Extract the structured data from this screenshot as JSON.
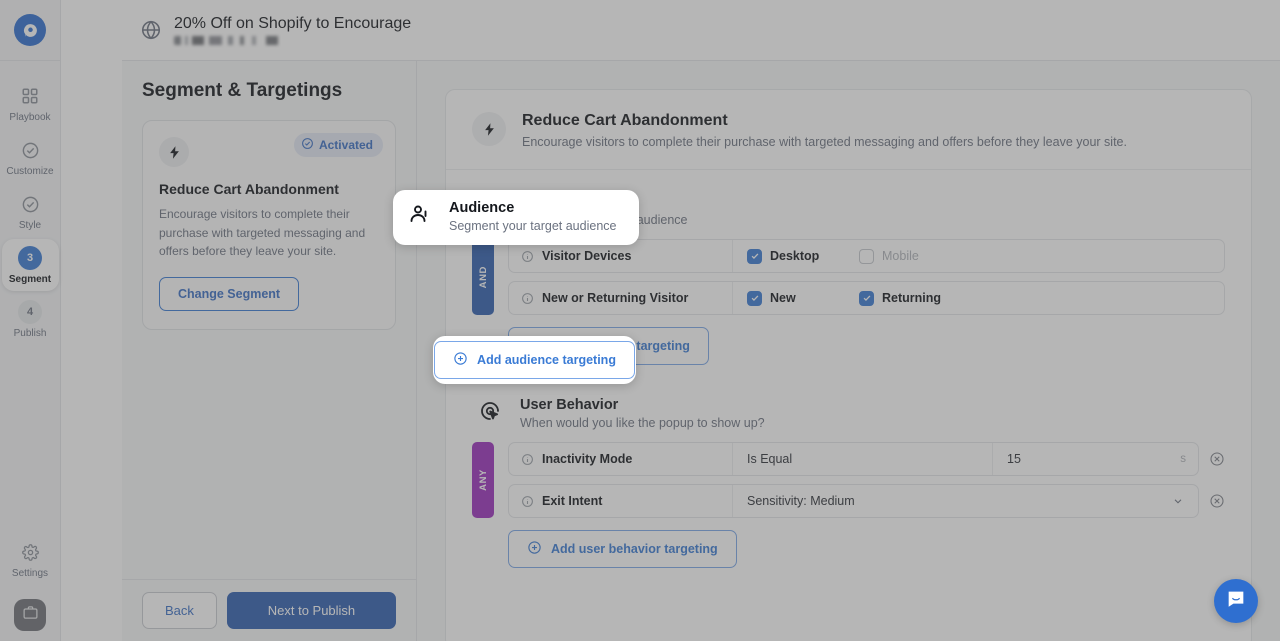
{
  "topbar": {
    "title": "20% Off on Shopify to Encourage",
    "subtitle_redacted": "",
    "globe_icon": "globe-icon"
  },
  "rail": {
    "logo_icon": "app-logo-icon",
    "items": [
      {
        "label": "Playbook",
        "icon": "grid-icon",
        "state": "plain"
      },
      {
        "label": "Customize",
        "icon": "check-circle-icon",
        "state": "done"
      },
      {
        "label": "Style",
        "icon": "check-circle-icon",
        "state": "done"
      },
      {
        "label": "Segment",
        "icon": "step-3",
        "state": "current",
        "step": "3"
      },
      {
        "label": "Publish",
        "icon": "step-4",
        "state": "upcoming",
        "step": "4"
      }
    ],
    "settings": {
      "label": "Settings",
      "icon": "gear-icon"
    },
    "briefcase": {
      "icon": "briefcase-icon"
    }
  },
  "left_panel": {
    "page_title": "Segment & Targetings",
    "card": {
      "badge": "Activated",
      "badge_icon": "check-circle-icon",
      "icon": "bolt-icon",
      "title": "Reduce Cart Abandonment",
      "description": "Encourage visitors to complete their purchase with targeted messaging and offers before they leave your site.",
      "button": "Change Segment"
    },
    "footer": {
      "back": "Back",
      "next": "Next to Publish"
    }
  },
  "main": {
    "header": {
      "icon": "bolt-icon",
      "title": "Reduce Cart Abandonment",
      "subtitle": "Encourage visitors to complete their purchase with targeted messaging and offers before they leave your site."
    },
    "audience": {
      "icon": "people-icon",
      "title": "Audience",
      "subtitle": "Segment your target audience",
      "conjunction": "AND",
      "conjunction_color": "#2f5fb0",
      "rules": [
        {
          "label": "Visitor Devices",
          "info_icon": "info-icon",
          "checkboxes": [
            {
              "label": "Desktop",
              "checked": true
            },
            {
              "label": "Mobile",
              "checked": false
            }
          ]
        },
        {
          "label": "New or Returning Visitor",
          "info_icon": "info-icon",
          "checkboxes": [
            {
              "label": "New",
              "checked": true
            },
            {
              "label": "Returning",
              "checked": true
            }
          ]
        }
      ],
      "add_button": "Add audience targeting",
      "add_icon": "plus-circle-icon"
    },
    "user_behavior": {
      "icon": "cursor-target-icon",
      "title": "User Behavior",
      "subtitle": "When would you like the popup to show up?",
      "conjunction": "ANY",
      "conjunction_color": "#9c2fbd",
      "rules": [
        {
          "label": "Inactivity Mode",
          "info_icon": "info-icon",
          "operator": "Is Equal",
          "value": "15",
          "unit": "s",
          "delete_icon": "remove-circle-icon"
        },
        {
          "label": "Exit Intent",
          "info_icon": "info-icon",
          "value": "Sensitivity: Medium",
          "chevron_icon": "chevron-down-icon",
          "delete_icon": "remove-circle-icon"
        }
      ],
      "add_button": "Add user behavior targeting",
      "add_icon": "plus-circle-icon"
    }
  },
  "chat": {
    "icon": "chat-bubble-icon"
  },
  "colors": {
    "accent_blue": "#3a7bd5",
    "primary_button": "#2f5fb0",
    "and_badge": "#2f5fb0",
    "any_badge": "#9c2fbd",
    "page_bg": "#f7f8f9"
  }
}
